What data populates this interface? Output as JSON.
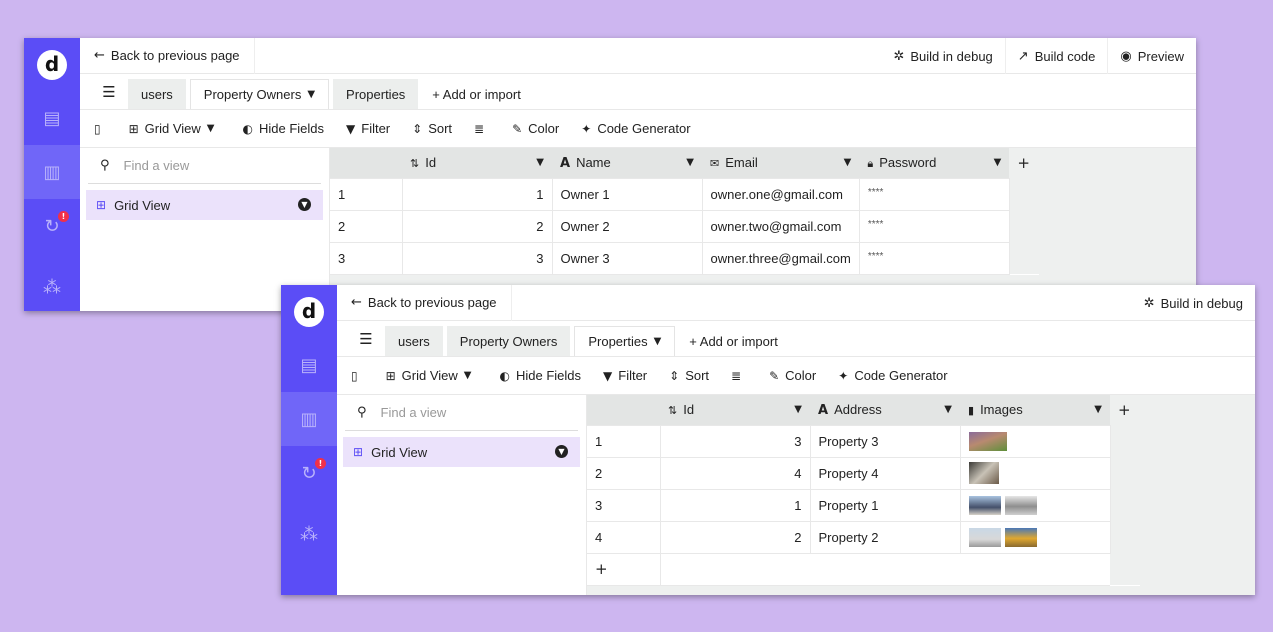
{
  "window1": {
    "logo": "d",
    "back_label": "Back to previous page",
    "debug_label": "Build in debug",
    "buildcode_label": "Build code",
    "preview_label": "Preview",
    "tabs": [
      {
        "label": "users"
      },
      {
        "label": "Property Owners"
      },
      {
        "label": "Properties"
      }
    ],
    "add_import_label": "+ Add or import",
    "toolbar": {
      "grid_view": "Grid View",
      "hide_fields": "Hide Fields",
      "filter": "Filter",
      "sort": "Sort",
      "color": "Color",
      "code_generator": "Code Generator"
    },
    "search_placeholder": "Find a view",
    "view_label": "Grid View",
    "columns": [
      "Id",
      "Name",
      "Email",
      "Password"
    ],
    "rows": [
      {
        "n": "1",
        "id": "1",
        "name": "Owner 1",
        "email": "owner.one@gmail.com",
        "password": "****"
      },
      {
        "n": "2",
        "id": "2",
        "name": "Owner 2",
        "email": "owner.two@gmail.com",
        "password": "****"
      },
      {
        "n": "3",
        "id": "3",
        "name": "Owner 3",
        "email": "owner.three@gmail.com",
        "password": "****"
      }
    ],
    "add_column": "+"
  },
  "window2": {
    "logo": "d",
    "back_label": "Back to previous page",
    "debug_label": "Build in debug",
    "tabs": [
      {
        "label": "users"
      },
      {
        "label": "Property Owners"
      },
      {
        "label": "Properties"
      }
    ],
    "add_import_label": "+ Add or import",
    "toolbar": {
      "grid_view": "Grid View",
      "hide_fields": "Hide Fields",
      "filter": "Filter",
      "sort": "Sort",
      "color": "Color",
      "code_generator": "Code Generator"
    },
    "search_placeholder": "Find a view",
    "view_label": "Grid View",
    "columns": [
      "Id",
      "Address",
      "Images"
    ],
    "rows": [
      {
        "n": "1",
        "id": "3",
        "address": "Property 3"
      },
      {
        "n": "2",
        "id": "4",
        "address": "Property 4"
      },
      {
        "n": "3",
        "id": "1",
        "address": "Property 1"
      },
      {
        "n": "4",
        "id": "2",
        "address": "Property 2"
      }
    ],
    "add_column": "+",
    "add_row": "+"
  },
  "colors": {
    "rail": "#5b4df6",
    "background": "#cdb6f0",
    "view_highlight": "#ebe2fb",
    "badge": "#f0304a"
  }
}
